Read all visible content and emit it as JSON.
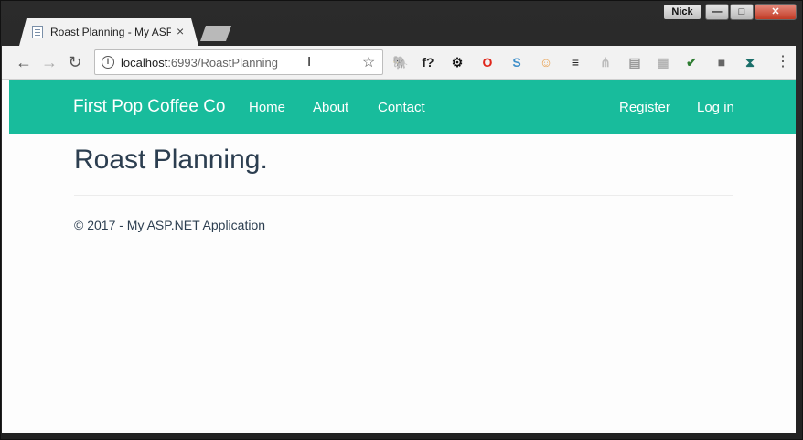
{
  "window": {
    "user_badge": "Nick",
    "minimize_label": "—",
    "maximize_label": "□",
    "close_label": "✕"
  },
  "tab": {
    "title": "Roast Planning - My ASP.",
    "close_glyph": "×"
  },
  "toolbar": {
    "back_glyph": "←",
    "forward_glyph": "→",
    "reload_glyph": "↻",
    "info_glyph": "i",
    "url_host": "localhost",
    "url_rest": ":6993/RoastPlanning",
    "star_glyph": "☆",
    "menu_glyph": "⋮",
    "extensions": [
      {
        "name": "evernote-icon",
        "glyph": "🐘",
        "color": "#3c3c3c"
      },
      {
        "name": "whatfont-icon",
        "glyph": "f?",
        "color": "#222222"
      },
      {
        "name": "settings-gear-icon",
        "glyph": "⚙",
        "color": "#111111"
      },
      {
        "name": "opera-icon",
        "glyph": "O",
        "color": "#e0261b"
      },
      {
        "name": "s-extension-icon",
        "glyph": "S",
        "color": "#3d8ec9"
      },
      {
        "name": "face-extension-icon",
        "glyph": "☺",
        "color": "#e9a04f"
      },
      {
        "name": "buffer-icon",
        "glyph": "≡",
        "color": "#222222"
      },
      {
        "name": "tree-extension-icon",
        "glyph": "⋔",
        "color": "#bbbbbb"
      },
      {
        "name": "css-extension-icon",
        "glyph": "▤",
        "color": "#9a9a9a"
      },
      {
        "name": "grid-extension-icon",
        "glyph": "▦",
        "color": "#b5b5b5"
      },
      {
        "name": "shield-check-icon",
        "glyph": "✔",
        "color": "#2e7d32"
      },
      {
        "name": "square-extension-icon",
        "glyph": "■",
        "color": "#666666"
      },
      {
        "name": "hourglass-extension-icon",
        "glyph": "⧗",
        "color": "#1b6f6a"
      }
    ]
  },
  "site": {
    "brand": "First Pop Coffee Co",
    "nav": {
      "home": "Home",
      "about": "About",
      "contact": "Contact",
      "register": "Register",
      "login": "Log in"
    },
    "page_title": "Roast Planning.",
    "footer": "© 2017 - My ASP.NET Application",
    "accent_color": "#18bc9c",
    "text_color": "#2c3e50"
  }
}
